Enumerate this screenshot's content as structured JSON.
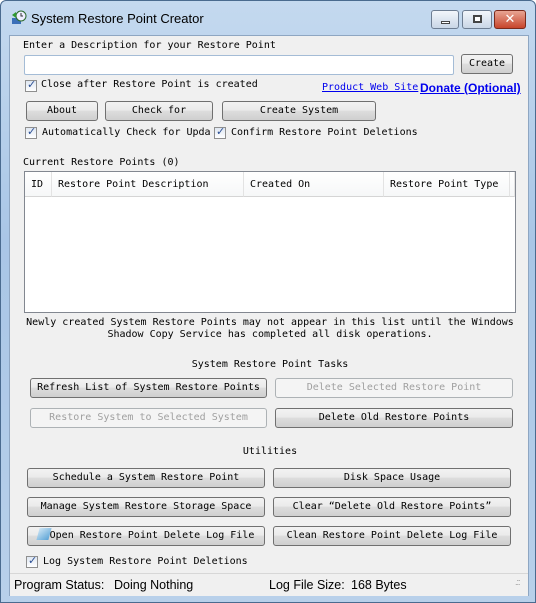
{
  "window": {
    "title": "System Restore Point Creator",
    "icon": "restore-clock-icon"
  },
  "description": {
    "label": "Enter a Description for your Restore Point",
    "value": "",
    "placeholder": "",
    "create_label": "Create"
  },
  "options": {
    "close_after": {
      "label": "Close after Restore Point is created",
      "checked": true
    },
    "auto_check": {
      "label": "Automatically Check for Updat",
      "checked": true
    },
    "confirm_delete": {
      "label": "Confirm Restore Point Deletions",
      "checked": true
    },
    "log_deletions": {
      "label": "Log System Restore Point Deletions",
      "checked": true
    }
  },
  "links": {
    "product": "Product Web Site",
    "donate": "Donate (Optional)"
  },
  "toolbar": {
    "about": "About",
    "check": "Check for",
    "create_system": "Create System"
  },
  "list": {
    "title": "Current Restore Points (0)",
    "columns": [
      "ID",
      "Restore Point Description",
      "Created On",
      "Restore Point Type"
    ],
    "rows": []
  },
  "note": {
    "line1": "Newly created System Restore Points may not appear in this list until the Windows",
    "line2": "Shadow Copy Service has completed all disk operations."
  },
  "tasks": {
    "title": "System Restore Point Tasks",
    "refresh": "Refresh List of System Restore Points",
    "delete_selected": "Delete Selected Restore Point",
    "restore_selected": "Restore System to Selected System",
    "delete_old": "Delete Old Restore Points"
  },
  "utilities": {
    "title": "Utilities",
    "schedule": "Schedule a System Restore Point",
    "disk": "Disk Space Usage",
    "manage": "Manage System Restore Storage Space",
    "clear": "Clear “Delete Old Restore Points”",
    "open_log": "Open Restore Point Delete Log File",
    "clean_log": "Clean Restore Point Delete Log File"
  },
  "status": {
    "program_label": "Program Status:",
    "program_value": "Doing Nothing",
    "log_label": "Log File Size:",
    "log_value": "168 Bytes"
  }
}
